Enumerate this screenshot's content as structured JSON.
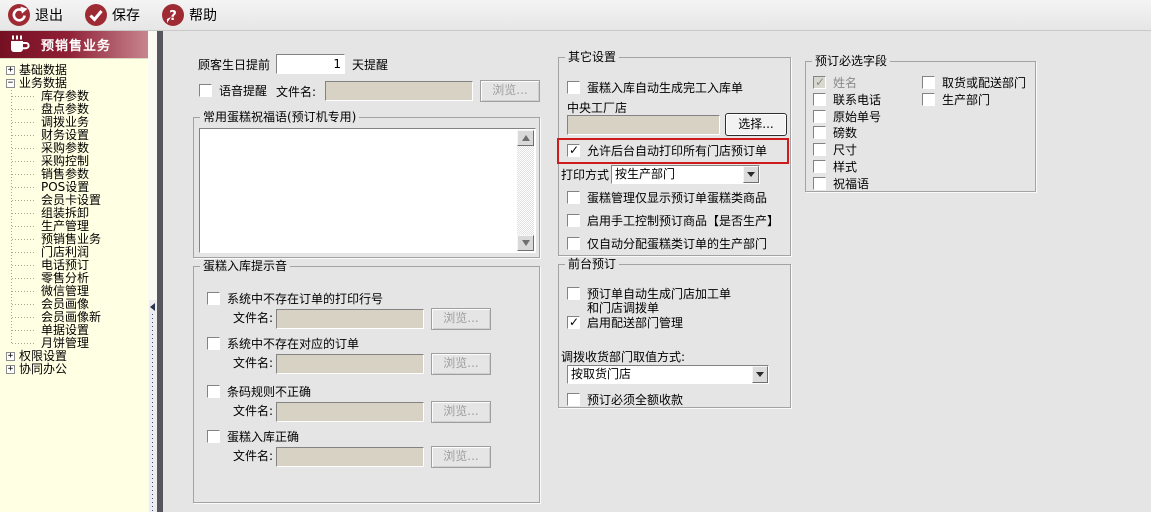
{
  "colors": {
    "accent_red": "#9e2b33",
    "highlight_red": "#cf1b1b",
    "sidebar_bg": "#ffffe3",
    "header_gradient_start": "#751022",
    "header_gradient_end": "#c8858e"
  },
  "toolbar": {
    "exit_label": "退出",
    "save_label": "保存",
    "help_label": "帮助"
  },
  "sidebar": {
    "title": "预销售业务",
    "tree": [
      {
        "label": "基础数据",
        "state": "collapsed",
        "children": []
      },
      {
        "label": "业务数据",
        "state": "expanded",
        "children": [
          "库存参数",
          "盘点参数",
          "调拨业务",
          "财务设置",
          "采购参数",
          "采购控制",
          "销售参数",
          "POS设置",
          "会员卡设置",
          "组装拆卸",
          "生产管理",
          "预销售业务",
          "门店利润",
          "电话预订",
          "零售分析",
          "微信管理",
          "会员画像",
          "会员画像新",
          "单据设置",
          "月饼管理"
        ]
      },
      {
        "label": "权限设置",
        "state": "collapsed",
        "children": []
      },
      {
        "label": "协同办公",
        "state": "collapsed",
        "children": []
      }
    ]
  },
  "main": {
    "birthday": {
      "prefix": "顾客生日提前",
      "value": "1",
      "suffix": "天提醒"
    },
    "voice": {
      "checkbox_label": "语音提醒",
      "file_label": "文件名:",
      "file_value": "",
      "browse_label": "浏览..."
    },
    "blessing": {
      "title": "常用蛋糕祝福语(预订机专用)",
      "text": ""
    },
    "sound": {
      "title": "蛋糕入库提示音",
      "file_label": "文件名:",
      "browse_label": "浏览...",
      "items": [
        {
          "label": "系统中不存在订单的打印行号",
          "checked": false,
          "file_value": ""
        },
        {
          "label": "系统中不存在对应的订单",
          "checked": false,
          "file_value": ""
        },
        {
          "label": "条码规则不正确",
          "checked": false,
          "file_value": ""
        },
        {
          "label": "蛋糕入库正确",
          "checked": false,
          "file_value": ""
        }
      ]
    },
    "other": {
      "title": "其它设置",
      "cb_auto_complete": "蛋糕入库自动生成完工入库单",
      "central_label": "中央工厂店",
      "central_value": "",
      "select_label": "选择...",
      "cb_auto_print": "允许后台自动打印所有门店预订单",
      "cb_auto_print_checked": true,
      "print_mode_label": "打印方式",
      "print_mode_value": "按生产部门",
      "cb_cake_only": "蛋糕管理仅显示预订单蛋糕类商品",
      "cb_manual_control": "启用手工控制预订商品【是否生产】",
      "cb_assign_dept": "仅自动分配蛋糕类订单的生产部门"
    },
    "front": {
      "title": "前台预订",
      "cb_auto_line1": "预订单自动生成门店加工单",
      "cb_auto_line2": "和门店调拨单",
      "cb_delivery": "启用配送部门管理",
      "cb_delivery_checked": true,
      "transfer_label": "调拨收货部门取值方式:",
      "transfer_value": "按取货门店",
      "cb_full_payment": "预订必须全额收款"
    },
    "required": {
      "title": "预订必选字段",
      "col1": [
        {
          "label": "姓名",
          "checked": true,
          "disabled": true
        },
        {
          "label": "联系电话",
          "checked": false
        },
        {
          "label": "原始单号",
          "checked": false
        },
        {
          "label": "磅数",
          "checked": false
        },
        {
          "label": "尺寸",
          "checked": false
        },
        {
          "label": "样式",
          "checked": false
        },
        {
          "label": "祝福语",
          "checked": false
        }
      ],
      "col2": [
        {
          "label": "取货或配送部门",
          "checked": false
        },
        {
          "label": "生产部门",
          "checked": false
        }
      ]
    }
  }
}
